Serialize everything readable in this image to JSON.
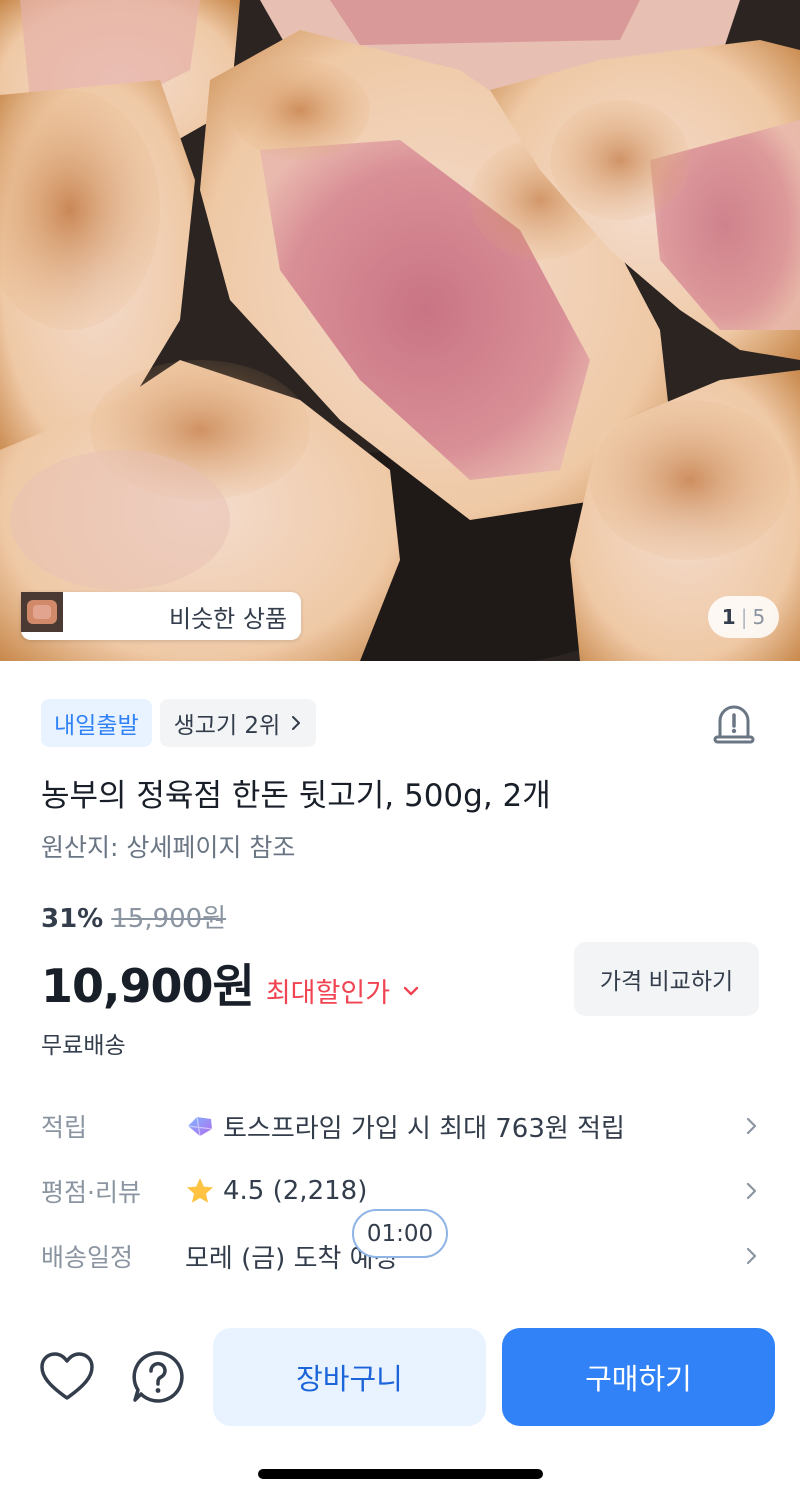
{
  "hero": {
    "similar_label": "비슷한 상품",
    "page_current": "1",
    "page_separator": "|",
    "page_total": "5"
  },
  "badges": {
    "delivery": "내일출발",
    "rank": "생고기 2위"
  },
  "product": {
    "title": "농부의 정육점 한돈 뒷고기, 500g, 2개",
    "origin": "원산지: 상세페이지 참조",
    "discount_rate": "31%",
    "original_price": "15,900원",
    "price": "10,900원",
    "max_discount_label": "최대할인가",
    "compare_label": "가격 비교하기",
    "shipping": "무료배송"
  },
  "info": {
    "points_key": "적립",
    "points_value": "토스프라임 가입 시 최대 763원 적립",
    "rating_key": "평점·리뷰",
    "rating_value": "4.5 (2,218)",
    "delivery_key": "배송일정",
    "delivery_value": "모레 (금) 도착 예정"
  },
  "timer": "01:00",
  "bottom": {
    "cart_label": "장바구니",
    "buy_label": "구매하기"
  },
  "icons": {
    "alarm": "alarm-siren-icon",
    "heart": "heart-icon",
    "help": "question-icon",
    "chevron": "chevron-right-icon",
    "star": "star-icon",
    "prime": "prime-gem-icon"
  },
  "colors": {
    "accent": "#3182f6",
    "discount_red": "#f04452",
    "star": "#ffc342"
  }
}
